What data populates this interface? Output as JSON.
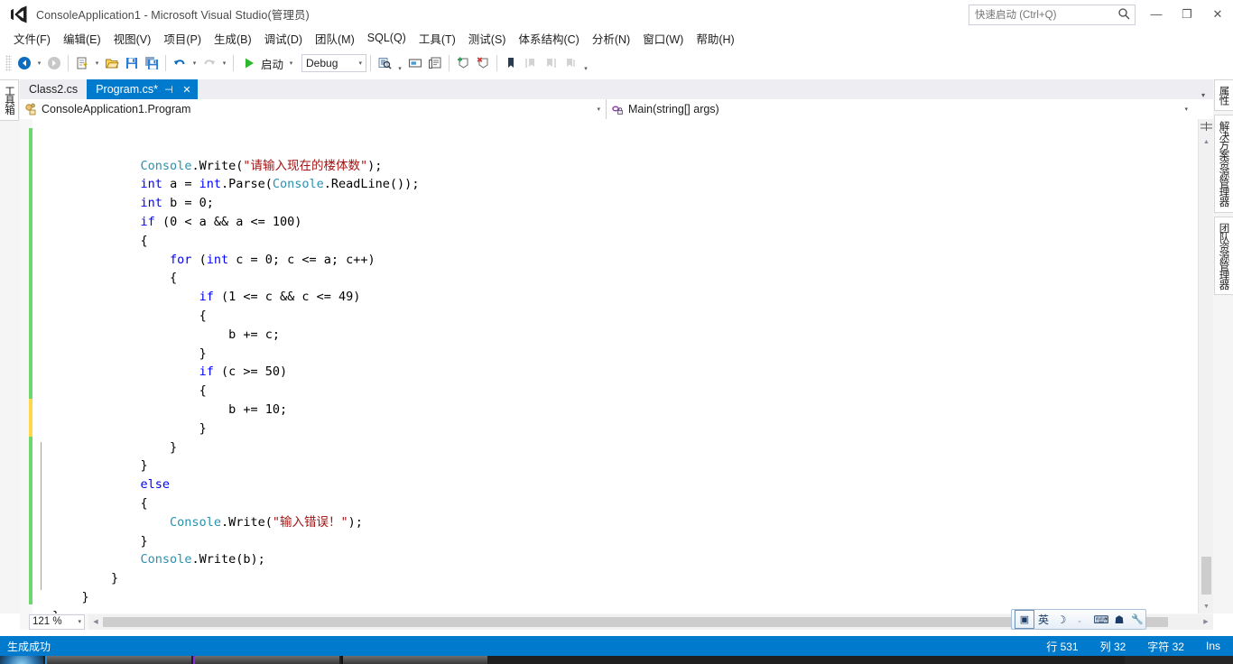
{
  "window": {
    "title": "ConsoleApplication1 - Microsoft Visual Studio(管理员)",
    "logo_icon": "visual-studio-logo-icon",
    "minimize_glyph": "—",
    "maximize_glyph": "❐",
    "close_glyph": "✕"
  },
  "quick_launch": {
    "placeholder": "快速启动 (Ctrl+Q)",
    "value": "",
    "icon": "search-icon"
  },
  "menubar": {
    "items": [
      {
        "label": "文件(F)",
        "name": "menu-file"
      },
      {
        "label": "编辑(E)",
        "name": "menu-edit"
      },
      {
        "label": "视图(V)",
        "name": "menu-view"
      },
      {
        "label": "项目(P)",
        "name": "menu-project"
      },
      {
        "label": "生成(B)",
        "name": "menu-build"
      },
      {
        "label": "调试(D)",
        "name": "menu-debug"
      },
      {
        "label": "团队(M)",
        "name": "menu-team"
      },
      {
        "label": "SQL(Q)",
        "name": "menu-sql"
      },
      {
        "label": "工具(T)",
        "name": "menu-tools"
      },
      {
        "label": "测试(S)",
        "name": "menu-test"
      },
      {
        "label": "体系结构(C)",
        "name": "menu-architecture"
      },
      {
        "label": "分析(N)",
        "name": "menu-analyze"
      },
      {
        "label": "窗口(W)",
        "name": "menu-window"
      },
      {
        "label": "帮助(H)",
        "name": "menu-help"
      }
    ]
  },
  "toolbar": {
    "start_label": "启动",
    "config_value": "Debug",
    "icons": [
      "navigate-back-icon",
      "navigate-forward-icon",
      "new-project-icon",
      "open-file-icon",
      "save-icon",
      "save-all-icon",
      "undo-icon",
      "redo-icon",
      "start-debug-icon",
      "find-in-files-icon",
      "comment-icon",
      "uncomment-icon",
      "add-bookmark-icon",
      "remove-bookmark-icon",
      "toggle-bookmark-icon",
      "previous-bookmark-icon",
      "next-bookmark-icon",
      "clear-bookmarks-icon"
    ],
    "overflow_glyph": "▾"
  },
  "left_dock": {
    "items": [
      {
        "label": "工具箱",
        "name": "dock-toolbox"
      }
    ]
  },
  "right_dock": {
    "items": [
      {
        "label": "属性",
        "name": "dock-properties"
      },
      {
        "label": "解决方案资源管理器",
        "name": "dock-solution-explorer"
      },
      {
        "label": "团队资源管理器",
        "name": "dock-team-explorer"
      }
    ]
  },
  "tabs": {
    "items": [
      {
        "label": "Class2.cs",
        "active": false,
        "name": "tab-class2-cs"
      },
      {
        "label": "Program.cs*",
        "active": true,
        "name": "tab-program-cs"
      }
    ],
    "pin_glyph": "⊣",
    "close_glyph": "✕",
    "overflow_glyph": "▾"
  },
  "navbar": {
    "type_icon": "class-member-icon",
    "type_value": "ConsoleApplication1.Program",
    "member_icon": "method-private-icon",
    "member_value": "Main(string[] args)",
    "caret_glyph": "▾"
  },
  "editor": {
    "zoom": "121 %",
    "zoom_caret": "▾",
    "change_bar_color_saved": "#6ed66e",
    "change_bar_color_unsaved": "#ffd74a",
    "lines": [
      {
        "indent": 12,
        "tokens": [
          {
            "t": "type",
            "v": "Console"
          },
          {
            "t": "pl",
            "v": ".Write("
          },
          {
            "t": "str",
            "v": "\"请输入现在的楼体数\""
          },
          {
            "t": "pl",
            "v": ");"
          }
        ]
      },
      {
        "indent": 12,
        "tokens": [
          {
            "t": "kw",
            "v": "int"
          },
          {
            "t": "pl",
            "v": " a = "
          },
          {
            "t": "kw",
            "v": "int"
          },
          {
            "t": "pl",
            "v": ".Parse("
          },
          {
            "t": "type",
            "v": "Console"
          },
          {
            "t": "pl",
            "v": ".ReadLine());"
          }
        ]
      },
      {
        "indent": 12,
        "tokens": [
          {
            "t": "kw",
            "v": "int"
          },
          {
            "t": "pl",
            "v": " b = 0;"
          }
        ]
      },
      {
        "indent": 12,
        "tokens": [
          {
            "t": "kw",
            "v": "if"
          },
          {
            "t": "pl",
            "v": " (0 < a && a <= 100)"
          }
        ]
      },
      {
        "indent": 12,
        "tokens": [
          {
            "t": "pl",
            "v": "{"
          }
        ]
      },
      {
        "indent": 16,
        "tokens": [
          {
            "t": "kw",
            "v": "for"
          },
          {
            "t": "pl",
            "v": " ("
          },
          {
            "t": "kw",
            "v": "int"
          },
          {
            "t": "pl",
            "v": " c = 0; c <= a; c++)"
          }
        ]
      },
      {
        "indent": 16,
        "tokens": [
          {
            "t": "pl",
            "v": "{"
          }
        ]
      },
      {
        "indent": 20,
        "tokens": [
          {
            "t": "kw",
            "v": "if"
          },
          {
            "t": "pl",
            "v": " (1 <= c && c <= 49)"
          }
        ]
      },
      {
        "indent": 20,
        "tokens": [
          {
            "t": "pl",
            "v": "{"
          }
        ]
      },
      {
        "indent": 24,
        "tokens": [
          {
            "t": "pl",
            "v": "b += c;"
          }
        ]
      },
      {
        "indent": 20,
        "tokens": [
          {
            "t": "pl",
            "v": "}"
          }
        ]
      },
      {
        "indent": 20,
        "tokens": [
          {
            "t": "kw",
            "v": "if"
          },
          {
            "t": "pl",
            "v": " (c >= 50)"
          }
        ]
      },
      {
        "indent": 20,
        "tokens": [
          {
            "t": "pl",
            "v": "{"
          }
        ]
      },
      {
        "indent": 24,
        "tokens": [
          {
            "t": "pl",
            "v": "b += 10;"
          }
        ]
      },
      {
        "indent": 20,
        "tokens": [
          {
            "t": "pl",
            "v": "}"
          }
        ]
      },
      {
        "indent": 16,
        "tokens": [
          {
            "t": "pl",
            "v": "}"
          }
        ]
      },
      {
        "indent": 12,
        "tokens": [
          {
            "t": "pl",
            "v": "}"
          }
        ]
      },
      {
        "indent": 12,
        "tokens": [
          {
            "t": "kw",
            "v": "else"
          }
        ]
      },
      {
        "indent": 12,
        "tokens": [
          {
            "t": "pl",
            "v": "{"
          }
        ]
      },
      {
        "indent": 16,
        "tokens": [
          {
            "t": "type",
            "v": "Console"
          },
          {
            "t": "pl",
            "v": ".Write("
          },
          {
            "t": "str",
            "v": "\"输入错误！\""
          },
          {
            "t": "pl",
            "v": ");"
          }
        ]
      },
      {
        "indent": 12,
        "tokens": [
          {
            "t": "pl",
            "v": "}"
          }
        ]
      },
      {
        "indent": 12,
        "tokens": [
          {
            "t": "type",
            "v": "Console"
          },
          {
            "t": "pl",
            "v": ".Write(b);"
          }
        ]
      },
      {
        "indent": 8,
        "tokens": [
          {
            "t": "pl",
            "v": "}"
          }
        ]
      },
      {
        "indent": 4,
        "tokens": [
          {
            "t": "pl",
            "v": "}"
          }
        ]
      },
      {
        "indent": 0,
        "tokens": [
          {
            "t": "pl",
            "v": "}"
          }
        ]
      }
    ]
  },
  "ime": {
    "items": [
      {
        "glyph": "▣",
        "name": "ime-mode-icon"
      },
      {
        "glyph": "英",
        "name": "ime-language-english"
      },
      {
        "glyph": "☽",
        "name": "ime-halfwidth-icon"
      },
      {
        "glyph": "„",
        "name": "ime-punctuation-icon"
      },
      {
        "glyph": "⌨",
        "name": "ime-soft-keyboard-icon"
      },
      {
        "glyph": "☗",
        "name": "ime-user-dictionary-icon"
      },
      {
        "glyph": "🔧",
        "name": "ime-settings-icon"
      }
    ]
  },
  "statusbar": {
    "message": "生成成功",
    "line": "行 531",
    "column": "列 32",
    "character": "字符 32",
    "insert_mode": "Ins"
  }
}
